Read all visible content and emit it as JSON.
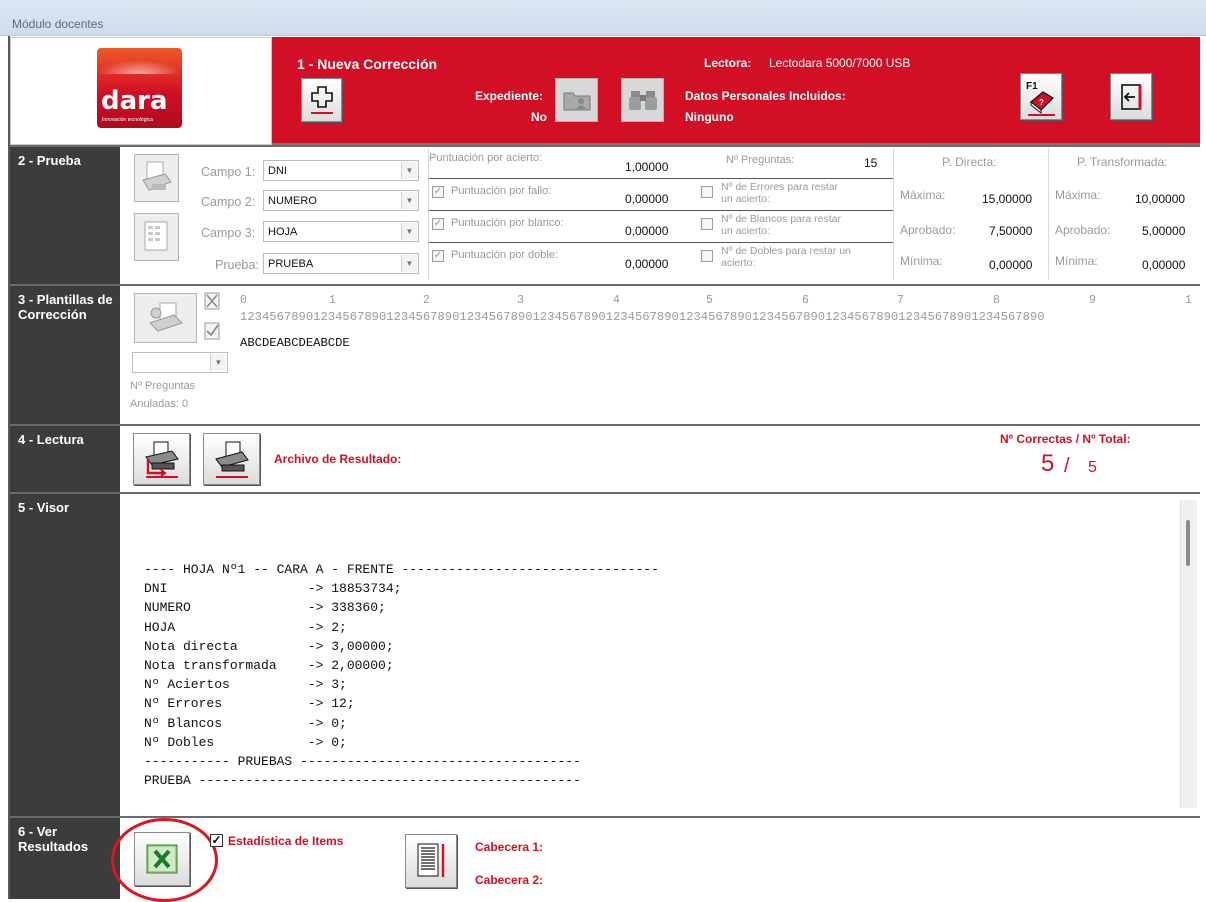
{
  "window": {
    "title": "Módulo docentes"
  },
  "logo": {
    "text": "dara",
    "tagline": "Innovación tecnológica"
  },
  "sec1": {
    "title": "1 - Nueva Corrección",
    "expediente_label": "Expediente:",
    "expediente_value": "No",
    "lectora_label": "Lectora:",
    "lectora_value": "Lectodara 5000/7000 USB",
    "datos_label": "Datos Personales Incluidos:",
    "datos_value": "Ninguno",
    "help_badge": "F1"
  },
  "sec2": {
    "label": "2 - Prueba",
    "campo1_label": "Campo 1:",
    "campo1_value": "DNI",
    "campo2_label": "Campo 2:",
    "campo2_value": "NUMERO",
    "campo3_label": "Campo 3:",
    "campo3_value": "HOJA",
    "prueba_label": "Prueba:",
    "prueba_value": "PRUEBA",
    "punt_acierto_label": "Puntuación por acierto:",
    "punt_acierto_value": "1,00000",
    "n_preguntas_label": "Nº Preguntas:",
    "n_preguntas_value": "15",
    "punt_fallo_label": "Puntuación por fallo:",
    "punt_fallo_value": "0,00000",
    "errores_label": "Nº de Errores para restar un acierto:",
    "punt_blanco_label": "Puntuación por blanco:",
    "punt_blanco_value": "0,00000",
    "blancos_label": "Nº de Blancos para restar un acierto:",
    "punt_doble_label": "Puntuación por doble:",
    "punt_doble_value": "0,00000",
    "dobles_label": "Nº de Dobles para restar un acierto:",
    "p_directa": {
      "title": "P. Directa:",
      "maxima_label": "Máxima:",
      "maxima": "15,00000",
      "aprobado_label": "Aprobado:",
      "aprobado": "7,50000",
      "minima_label": "Mínima:",
      "minima": "0,00000"
    },
    "p_transformada": {
      "title": "P. Transformada:",
      "maxima_label": "Máxima:",
      "maxima": "10,00000",
      "aprobado_label": "Aprobado:",
      "aprobado": "5,00000",
      "minima_label": "Mínima:",
      "minima": "0,00000"
    }
  },
  "sec3": {
    "label": "3 - Plantillas de Corrección",
    "ruler_tens": [
      "0",
      "1",
      "2",
      "3",
      "4",
      "5",
      "6",
      "7",
      "8",
      "9",
      "1"
    ],
    "ruler_digits": "12345678901234567890123456789012345678901234567890123456789012345678901234567890123456789012345678901234567890",
    "template": "ABCDEABCDEABCDE",
    "anuladas_line1": "Nº Preguntas",
    "anuladas_line2": "Anuladas: 0"
  },
  "sec4": {
    "label": "4 - Lectura",
    "archivo_label": "Archivo de Resultado:",
    "correctas_label": "Nº Correctas / Nº Total:",
    "correctas": "5",
    "separator": "/",
    "total": "5"
  },
  "sec5": {
    "label": "5 - Visor",
    "text": "---- HOJA Nº1 -- CARA A - FRENTE ---------------------------------\nDNI                  -> 18853734;\nNUMERO               -> 338360;\nHOJA                 -> 2;\nNota directa         -> 3,00000;\nNota transformada    -> 2,00000;\nNº Aciertos          -> 3;\nNº Errores           -> 12;\nNº Blancos           -> 0;\nNº Dobles            -> 0;\n----------- PRUEBAS ------------------------------------\nPRUEBA -------------------------------------------------"
  },
  "sec6": {
    "label": "6 - Ver Resultados",
    "estadistica_label": "Estadística de Items",
    "cabecera1_label": "Cabecera 1:",
    "cabecera2_label": "Cabecera 2:"
  },
  "colors": {
    "brand_red": "#d20f25",
    "section_dark": "#3c3c3c",
    "annotation_circle": "#e0141c"
  }
}
